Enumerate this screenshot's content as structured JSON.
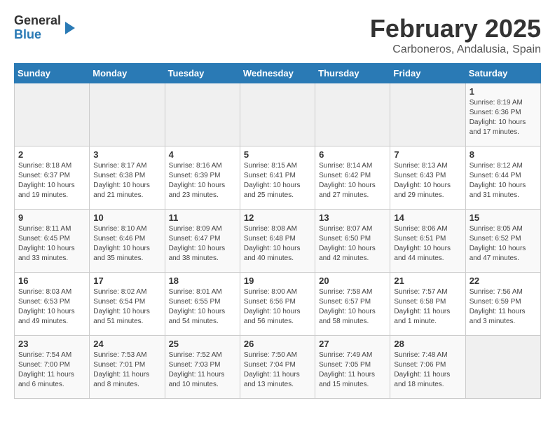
{
  "logo": {
    "general": "General",
    "blue": "Blue"
  },
  "title": "February 2025",
  "subtitle": "Carboneros, Andalusia, Spain",
  "headers": [
    "Sunday",
    "Monday",
    "Tuesday",
    "Wednesday",
    "Thursday",
    "Friday",
    "Saturday"
  ],
  "weeks": [
    [
      {
        "day": "",
        "info": ""
      },
      {
        "day": "",
        "info": ""
      },
      {
        "day": "",
        "info": ""
      },
      {
        "day": "",
        "info": ""
      },
      {
        "day": "",
        "info": ""
      },
      {
        "day": "",
        "info": ""
      },
      {
        "day": "1",
        "info": "Sunrise: 8:19 AM\nSunset: 6:36 PM\nDaylight: 10 hours\nand 17 minutes."
      }
    ],
    [
      {
        "day": "2",
        "info": "Sunrise: 8:18 AM\nSunset: 6:37 PM\nDaylight: 10 hours\nand 19 minutes."
      },
      {
        "day": "3",
        "info": "Sunrise: 8:17 AM\nSunset: 6:38 PM\nDaylight: 10 hours\nand 21 minutes."
      },
      {
        "day": "4",
        "info": "Sunrise: 8:16 AM\nSunset: 6:39 PM\nDaylight: 10 hours\nand 23 minutes."
      },
      {
        "day": "5",
        "info": "Sunrise: 8:15 AM\nSunset: 6:41 PM\nDaylight: 10 hours\nand 25 minutes."
      },
      {
        "day": "6",
        "info": "Sunrise: 8:14 AM\nSunset: 6:42 PM\nDaylight: 10 hours\nand 27 minutes."
      },
      {
        "day": "7",
        "info": "Sunrise: 8:13 AM\nSunset: 6:43 PM\nDaylight: 10 hours\nand 29 minutes."
      },
      {
        "day": "8",
        "info": "Sunrise: 8:12 AM\nSunset: 6:44 PM\nDaylight: 10 hours\nand 31 minutes."
      }
    ],
    [
      {
        "day": "9",
        "info": "Sunrise: 8:11 AM\nSunset: 6:45 PM\nDaylight: 10 hours\nand 33 minutes."
      },
      {
        "day": "10",
        "info": "Sunrise: 8:10 AM\nSunset: 6:46 PM\nDaylight: 10 hours\nand 35 minutes."
      },
      {
        "day": "11",
        "info": "Sunrise: 8:09 AM\nSunset: 6:47 PM\nDaylight: 10 hours\nand 38 minutes."
      },
      {
        "day": "12",
        "info": "Sunrise: 8:08 AM\nSunset: 6:48 PM\nDaylight: 10 hours\nand 40 minutes."
      },
      {
        "day": "13",
        "info": "Sunrise: 8:07 AM\nSunset: 6:50 PM\nDaylight: 10 hours\nand 42 minutes."
      },
      {
        "day": "14",
        "info": "Sunrise: 8:06 AM\nSunset: 6:51 PM\nDaylight: 10 hours\nand 44 minutes."
      },
      {
        "day": "15",
        "info": "Sunrise: 8:05 AM\nSunset: 6:52 PM\nDaylight: 10 hours\nand 47 minutes."
      }
    ],
    [
      {
        "day": "16",
        "info": "Sunrise: 8:03 AM\nSunset: 6:53 PM\nDaylight: 10 hours\nand 49 minutes."
      },
      {
        "day": "17",
        "info": "Sunrise: 8:02 AM\nSunset: 6:54 PM\nDaylight: 10 hours\nand 51 minutes."
      },
      {
        "day": "18",
        "info": "Sunrise: 8:01 AM\nSunset: 6:55 PM\nDaylight: 10 hours\nand 54 minutes."
      },
      {
        "day": "19",
        "info": "Sunrise: 8:00 AM\nSunset: 6:56 PM\nDaylight: 10 hours\nand 56 minutes."
      },
      {
        "day": "20",
        "info": "Sunrise: 7:58 AM\nSunset: 6:57 PM\nDaylight: 10 hours\nand 58 minutes."
      },
      {
        "day": "21",
        "info": "Sunrise: 7:57 AM\nSunset: 6:58 PM\nDaylight: 11 hours\nand 1 minute."
      },
      {
        "day": "22",
        "info": "Sunrise: 7:56 AM\nSunset: 6:59 PM\nDaylight: 11 hours\nand 3 minutes."
      }
    ],
    [
      {
        "day": "23",
        "info": "Sunrise: 7:54 AM\nSunset: 7:00 PM\nDaylight: 11 hours\nand 6 minutes."
      },
      {
        "day": "24",
        "info": "Sunrise: 7:53 AM\nSunset: 7:01 PM\nDaylight: 11 hours\nand 8 minutes."
      },
      {
        "day": "25",
        "info": "Sunrise: 7:52 AM\nSunset: 7:03 PM\nDaylight: 11 hours\nand 10 minutes."
      },
      {
        "day": "26",
        "info": "Sunrise: 7:50 AM\nSunset: 7:04 PM\nDaylight: 11 hours\nand 13 minutes."
      },
      {
        "day": "27",
        "info": "Sunrise: 7:49 AM\nSunset: 7:05 PM\nDaylight: 11 hours\nand 15 minutes."
      },
      {
        "day": "28",
        "info": "Sunrise: 7:48 AM\nSunset: 7:06 PM\nDaylight: 11 hours\nand 18 minutes."
      },
      {
        "day": "",
        "info": ""
      }
    ]
  ]
}
